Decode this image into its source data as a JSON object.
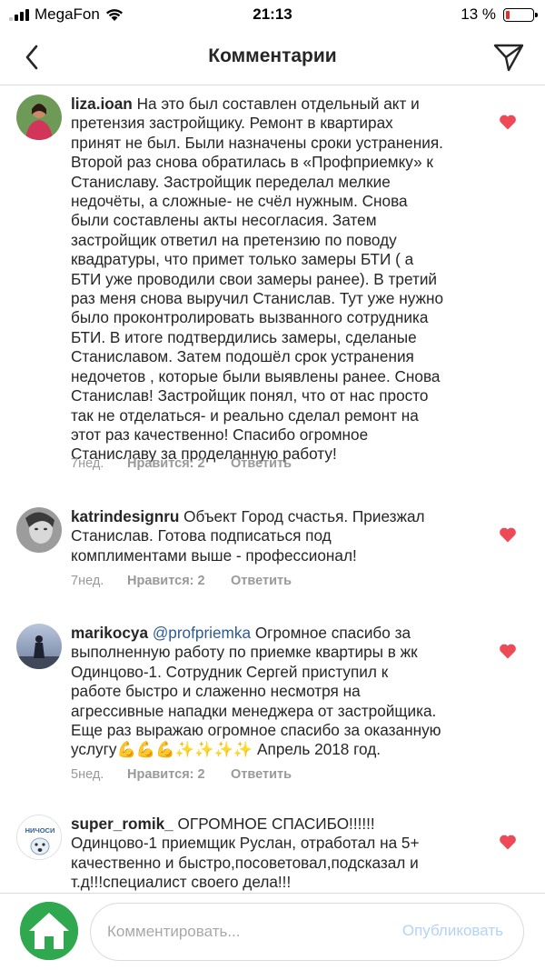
{
  "status_bar": {
    "carrier": "MegaFon",
    "time": "21:13",
    "battery": "13 %",
    "battery_level": 0.13
  },
  "header": {
    "title": "Комментарии",
    "back_icon": "chevron-left-icon",
    "send_icon": "paper-plane-icon"
  },
  "comments": [
    {
      "username": "liza.ioan",
      "lines": [
        "На это был составлен отдельный акт и",
        "претензия застройщику. Ремонт в квартирах",
        "принят не был. Были назначены сроки устранения.",
        "Второй раз снова обратилась в «Профприемку» к",
        "Станиславу. Застройщик переделал мелкие",
        "недочёты, а сложные- не счёл нужным. Снова",
        "были составлены акты несогласия. Затем",
        "застройщик ответил на претензию по поводу",
        "квадратуры, что примет только замеры БТИ ( а",
        "БТИ уже проводили свои замеры ранее). В третий",
        "раз меня снова выручил Станислав. Тут уже нужно",
        "было проконтролировать вызванного сотрудника",
        "БТИ. В итоге подтвердились замеры, сделаные",
        "Станиславом. Затем подошёл срок устранения",
        "недочетов , которые были выявлены ранее. Снова",
        "Станислав! Застройщик понял, что от нас просто",
        "так не отделаться- и реально сделал ремонт на",
        "этот раз качественно! Спасибо огромное",
        "Станиславу за проделанную работу!"
      ],
      "age": "7нед.",
      "likes": "Нравится: 2",
      "reply": "Ответить",
      "liked": true
    },
    {
      "username": "katrindesignru",
      "lines": [
        "Объект Город счастья. Приезжал",
        "Станислав. Готова подписаться под",
        "комплиментами выше - профессионал!"
      ],
      "age": "7нед.",
      "likes": "Нравится: 2",
      "reply": "Ответить",
      "liked": true
    },
    {
      "username": "marikocya",
      "mention": "@profpriemka",
      "lines": [
        "Огромное спасибо за",
        "выполненную работу по приемке квартиры в жк",
        "Одинцово-1.  Сотрудник Сергей приступил к",
        "работе быстро и слаженно несмотря на",
        "агрессивные нападки менеджера от застройщика.",
        "Еще раз выражаю огромное спасибо за оказанную",
        "услугу💪💪💪✨✨✨✨ Апрель 2018 год."
      ],
      "age": "5нед.",
      "likes": "Нравится: 2",
      "reply": "Ответить",
      "liked": true
    },
    {
      "username": "super_romik_",
      "lines": [
        "ОГРОМНОЕ СПАСИБО!!!!!!",
        "Одинцово-1 приемщик Руслан, отработал на 5+",
        "качественно и быстро,посоветовал,подсказал и",
        "т.д!!!специалист своего дела!!!"
      ],
      "liked": true
    }
  ],
  "avatar_labels": {
    "super_romik_": "НИЧОСИ"
  },
  "composer": {
    "placeholder": "Комментировать...",
    "publish": "Опубликовать"
  },
  "colors": {
    "heart": "#ed4956",
    "mention": "#2c5a94",
    "meta": "#999999",
    "publish_disabled": "#b3d4f5",
    "home_avatar": "#2fa84f"
  }
}
